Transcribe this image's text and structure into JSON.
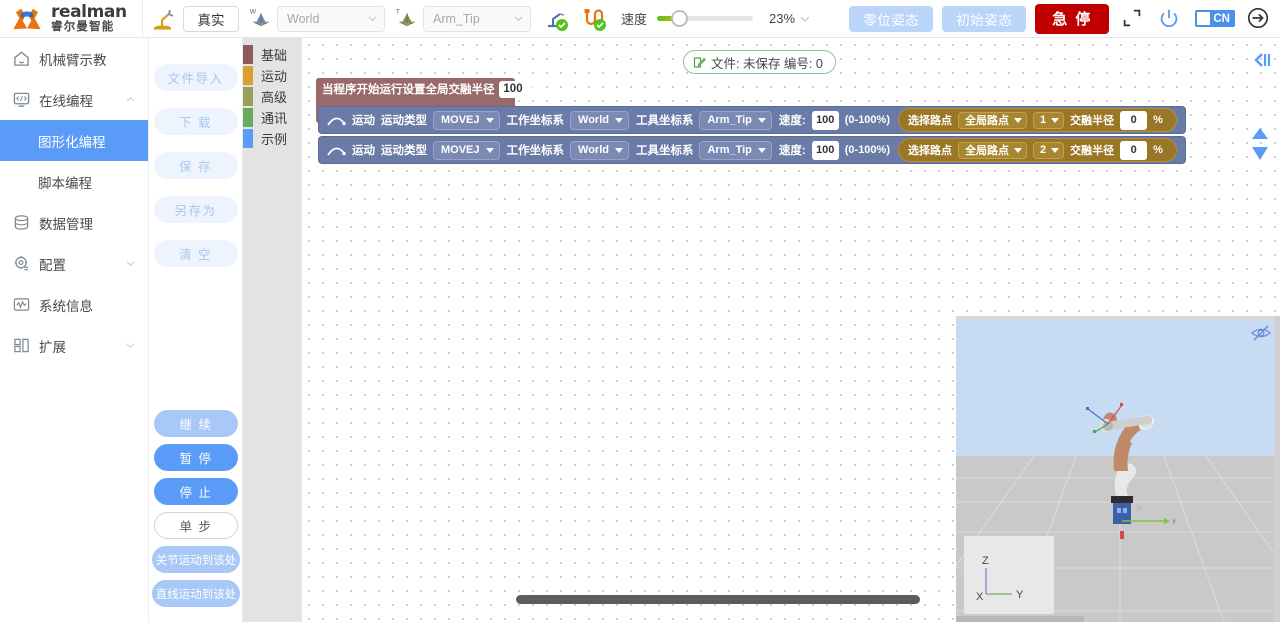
{
  "header": {
    "logo_en": "realman",
    "logo_cn": "睿尔曼智能",
    "mode_button": "真实",
    "work_frame": {
      "value": "World",
      "axis_tag": "W"
    },
    "tool_frame": {
      "value": "Arm_Tip",
      "axis_tag": "T"
    },
    "speed_label": "速度",
    "speed_percent": "23%",
    "speed_value": 23,
    "buttons": {
      "zero_pose": "零位姿态",
      "init_pose": "初始姿态",
      "estop": "急 停"
    },
    "language": "CN"
  },
  "sidebar": {
    "items": [
      {
        "label": "机械臂示教",
        "icon": "home-icon",
        "expandable": false
      },
      {
        "label": "在线编程",
        "icon": "code-icon",
        "expandable": true,
        "expanded": true
      },
      {
        "label": "数据管理",
        "icon": "database-icon",
        "expandable": false
      },
      {
        "label": "配置",
        "icon": "gear-icon",
        "expandable": true,
        "expanded": false
      },
      {
        "label": "系统信息",
        "icon": "chart-icon",
        "expandable": false
      },
      {
        "label": "扩展",
        "icon": "grid-icon",
        "expandable": true,
        "expanded": false
      }
    ],
    "sub_items": [
      {
        "label": "图形化编程",
        "active": true
      },
      {
        "label": "脚本编程",
        "active": false
      }
    ]
  },
  "file_panel": {
    "buttons": [
      {
        "label": "文件导入",
        "style": "light"
      },
      {
        "label": "下 载",
        "style": "light"
      },
      {
        "label": "保 存",
        "style": "light"
      },
      {
        "label": "另存为",
        "style": "light"
      },
      {
        "label": "清 空",
        "style": "light"
      }
    ]
  },
  "run_panel": {
    "buttons": [
      {
        "label": "继 续",
        "style": "soft"
      },
      {
        "label": "暂 停",
        "style": "solid"
      },
      {
        "label": "停 止",
        "style": "solid"
      },
      {
        "label": "单 步",
        "style": "ghost"
      },
      {
        "label": "关节运动到该处",
        "style": "soft-wide"
      },
      {
        "label": "直线运动到该处",
        "style": "soft-wide"
      }
    ]
  },
  "categories": [
    {
      "label": "基础",
      "color": "#8c5a5a"
    },
    {
      "label": "运动",
      "color": "#d9a030"
    },
    {
      "label": "高级",
      "color": "#9aa05a"
    },
    {
      "label": "通讯",
      "color": "#6aaa5a"
    },
    {
      "label": "示例",
      "color": "#5b9bf8"
    }
  ],
  "canvas": {
    "file_status": "文件: 未保存 编号: 0",
    "program_header": {
      "on_start": "当程序开始运行",
      "set_radius": "设置全局交融半径",
      "radius_value": "100",
      "unit": "%"
    },
    "blocks": [
      {
        "motion_label": "运动",
        "type_label": "运动类型",
        "type_value": "MOVEJ",
        "work_frame_label": "工作坐标系",
        "work_frame_value": "World",
        "tool_frame_label": "工具坐标系",
        "tool_frame_value": "Arm_Tip",
        "speed_label": "速度:",
        "speed_value": "100",
        "speed_range": "(0-100%)",
        "waypoint_label": "选择路点",
        "waypoint_source": "全局路点",
        "waypoint_index": "1",
        "blend_label": "交融半径",
        "blend_value": "0",
        "blend_unit": "%"
      },
      {
        "motion_label": "运动",
        "type_label": "运动类型",
        "type_value": "MOVEJ",
        "work_frame_label": "工作坐标系",
        "work_frame_value": "World",
        "tool_frame_label": "工具坐标系",
        "tool_frame_value": "Arm_Tip",
        "speed_label": "速度:",
        "speed_value": "100",
        "speed_range": "(0-100%)",
        "waypoint_label": "选择路点",
        "waypoint_source": "全局路点",
        "waypoint_index": "2",
        "blend_label": "交融半径",
        "blend_value": "0",
        "blend_unit": "%"
      }
    ]
  },
  "viewport": {
    "gizmo": {
      "x": "X",
      "y": "Y",
      "z": "Z"
    }
  }
}
